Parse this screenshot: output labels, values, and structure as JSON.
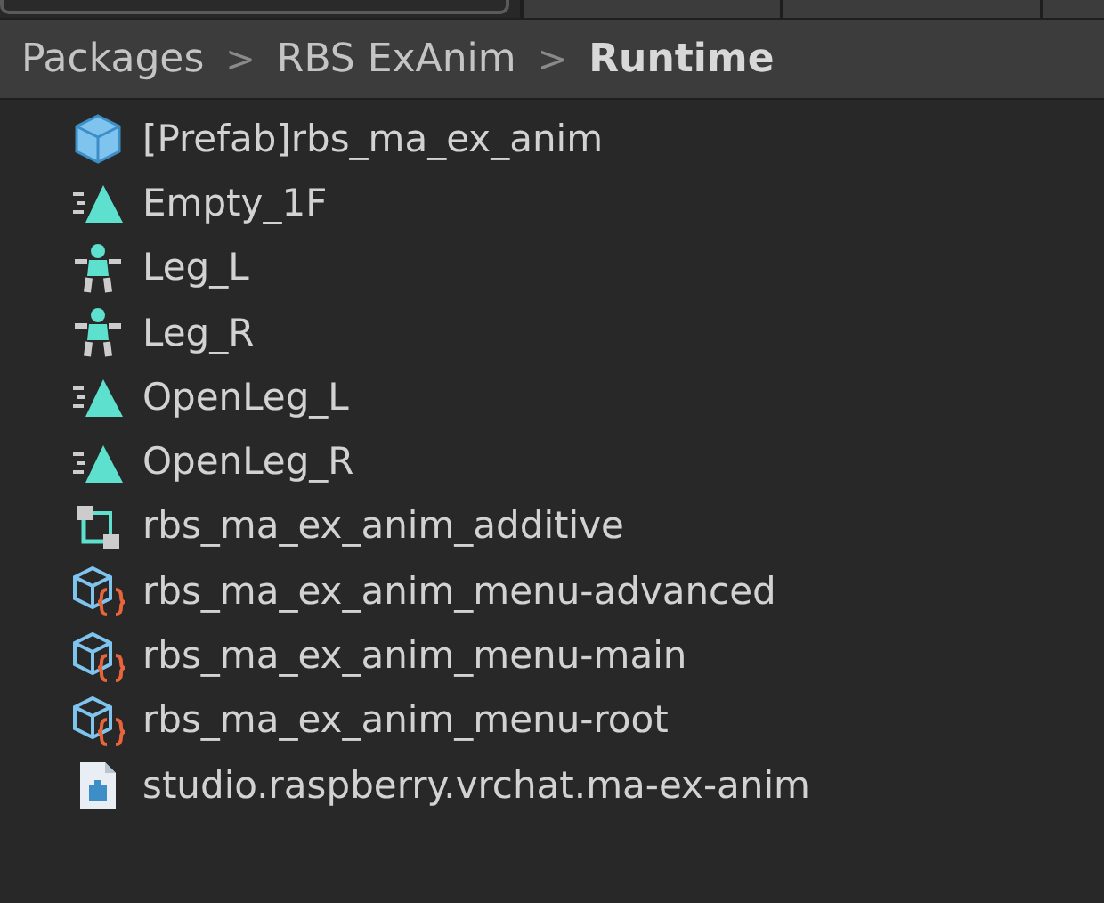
{
  "breadcrumb": [
    {
      "label": "Packages",
      "current": false
    },
    {
      "label": "RBS ExAnim",
      "current": false
    },
    {
      "label": "Runtime",
      "current": true
    }
  ],
  "breadcrumb_separator": ">",
  "assets": [
    {
      "name": "[Prefab]rbs_ma_ex_anim",
      "kind": "prefab"
    },
    {
      "name": "Empty_1F",
      "kind": "animation"
    },
    {
      "name": "Leg_L",
      "kind": "mask"
    },
    {
      "name": "Leg_R",
      "kind": "mask"
    },
    {
      "name": "OpenLeg_L",
      "kind": "animation"
    },
    {
      "name": "OpenLeg_R",
      "kind": "animation"
    },
    {
      "name": "rbs_ma_ex_anim_additive",
      "kind": "controller"
    },
    {
      "name": "rbs_ma_ex_anim_menu-advanced",
      "kind": "script-asset"
    },
    {
      "name": "rbs_ma_ex_anim_menu-main",
      "kind": "script-asset"
    },
    {
      "name": "rbs_ma_ex_anim_menu-root",
      "kind": "script-asset"
    },
    {
      "name": "studio.raspberry.vrchat.ma-ex-anim",
      "kind": "package"
    }
  ]
}
